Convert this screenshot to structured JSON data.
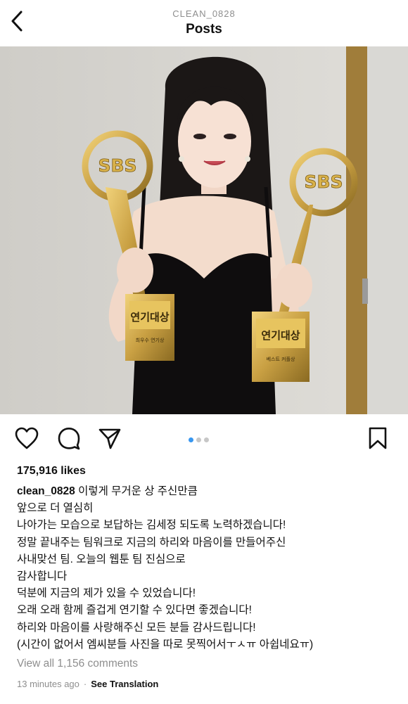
{
  "header": {
    "username": "CLEAN_0828",
    "title": "Posts"
  },
  "photo": {
    "trophy_left": {
      "brand": "SBS",
      "plaque": "연기대상",
      "subtitle": "최우수 연기상"
    },
    "trophy_right": {
      "brand": "SBS",
      "plaque": "연기대상",
      "subtitle": "베스트 커플상"
    }
  },
  "actions": {
    "icons": [
      "heart-icon",
      "comment-icon",
      "share-icon",
      "bookmark-icon"
    ],
    "carousel": {
      "count": 3,
      "active_index": 0
    }
  },
  "post": {
    "likes": "175,916 likes",
    "author": "clean_0828",
    "caption_lines": [
      "이렇게 무거운 상 주신만큼",
      "앞으로 더 열심히",
      "나아가는 모습으로 보답하는 김세정 되도록 노력하겠습니다!",
      "정말 끝내주는 팀워크로 지금의 하리와 마음이를 만들어주신",
      "사내맞선 팀. 오늘의 웹툰 팀 진심으로",
      "감사합니다",
      "덕분에 지금의 제가 있을 수 있었습니다!",
      "오래 오래 함께 즐겁게 연기할 수 있다면 좋겠습니다!",
      "하리와 마음이를 사랑해주신 모든 분들 감사드립니다!",
      "(시간이 없어서 엠씨분들 사진을 따로 못찍어서ㅜㅅㅠ 아쉽네요ㅠ)"
    ],
    "comments_link": "View all 1,156 comments",
    "time": "13 minutes ago",
    "separator": "·",
    "translate": "See Translation"
  },
  "colors": {
    "accent_blue": "#3897f0",
    "text": "#111111",
    "muted": "#8e8e8e",
    "gold": "#c9a043"
  }
}
